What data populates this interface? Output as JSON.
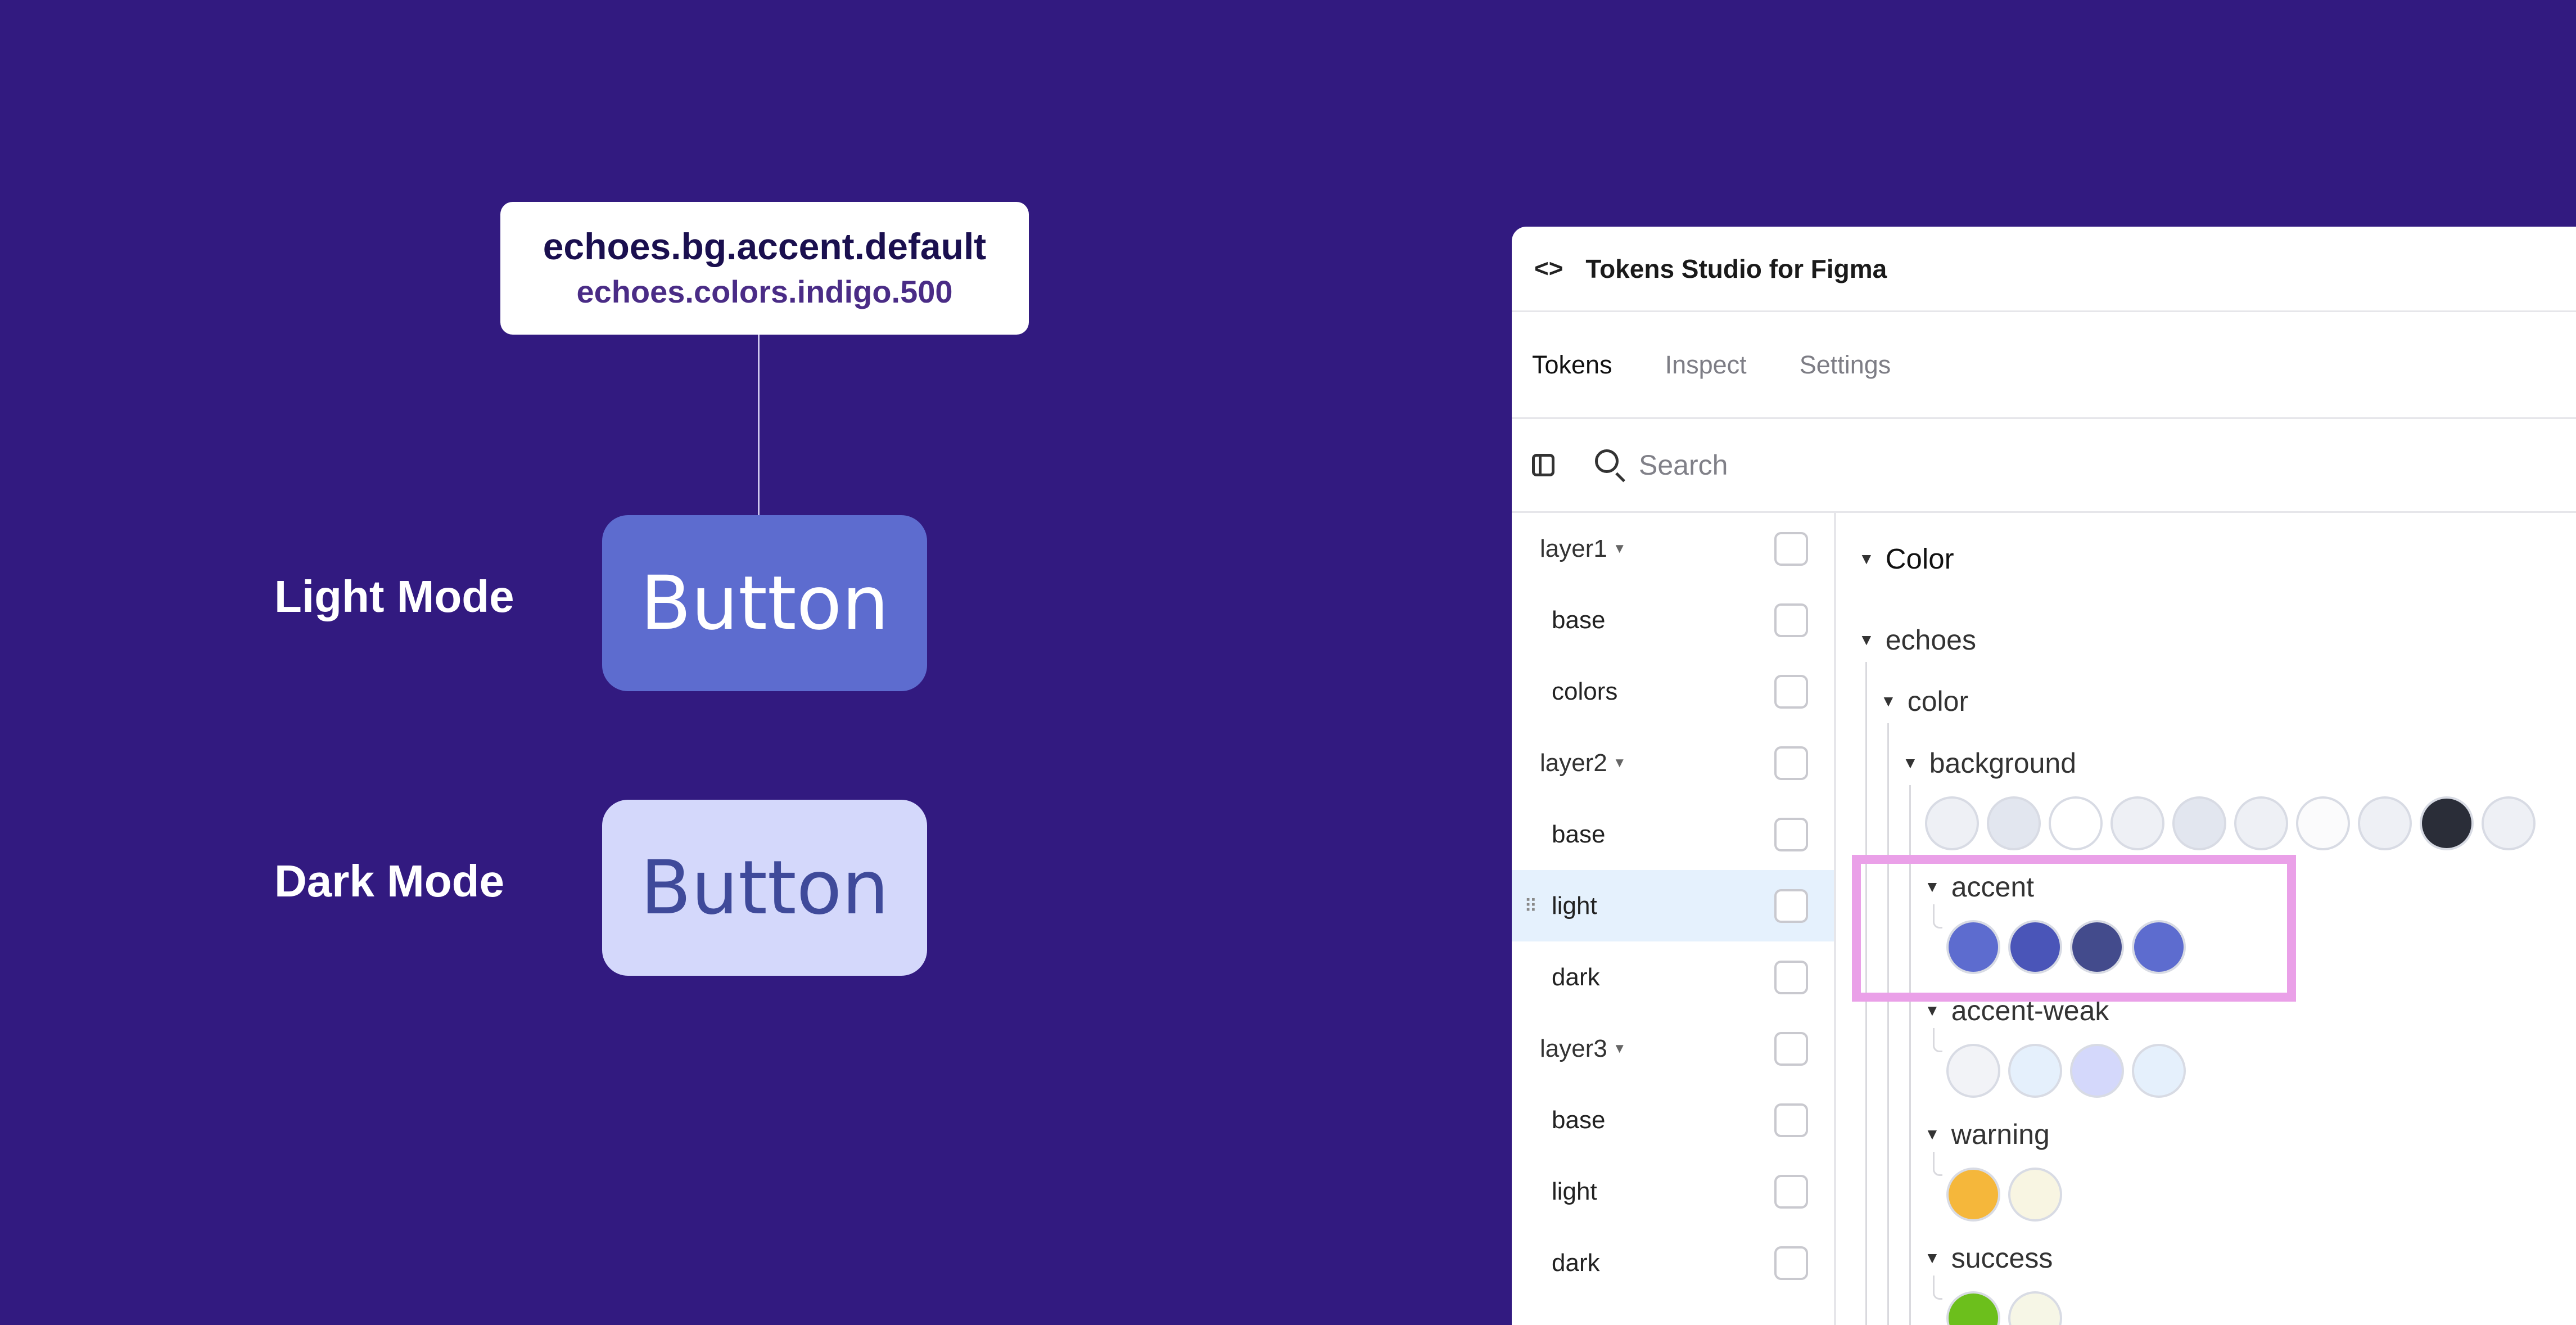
{
  "showcase": {
    "token_name": "echoes.bg.accent.default",
    "token_ref": "echoes.colors.indigo.500",
    "light_label": "Light Mode",
    "dark_label": "Dark Mode",
    "light_button": {
      "label": "Button",
      "bg": "#5d6ccf",
      "fg": "#ffffff"
    },
    "dark_button": {
      "label": "Button",
      "bg": "#d4d8fb",
      "fg": "#3f4a9a"
    }
  },
  "plugin": {
    "title": "Tokens Studio for Figma",
    "tabs": [
      {
        "label": "Tokens",
        "active": true
      },
      {
        "label": "Inspect",
        "active": false
      },
      {
        "label": "Settings",
        "active": false
      }
    ],
    "search": {
      "placeholder": "Search",
      "value": ""
    },
    "themes": [
      {
        "label": "layer1",
        "type": "group"
      },
      {
        "label": "base",
        "type": "child"
      },
      {
        "label": "colors",
        "type": "child"
      },
      {
        "label": "layer2",
        "type": "group"
      },
      {
        "label": "base",
        "type": "child"
      },
      {
        "label": "light",
        "type": "child",
        "active": true
      },
      {
        "label": "dark",
        "type": "child"
      },
      {
        "label": "layer3",
        "type": "group"
      },
      {
        "label": "base",
        "type": "child"
      },
      {
        "label": "light",
        "type": "child"
      },
      {
        "label": "dark",
        "type": "child"
      }
    ],
    "tree": {
      "root": "Color",
      "set": "echoes",
      "category": "color",
      "groups": [
        {
          "name": "background",
          "swatches": [
            "#eef0f5",
            "#e2e6ef",
            "#ffffff",
            "#eef0f5",
            "#e2e6ef",
            "#eef0f5",
            "#fbfbfc",
            "#eef0f5",
            "#2a2d38",
            "#eef0f5"
          ]
        },
        {
          "name": "accent",
          "swatches": [
            "#5d6ccf",
            "#4a55b8",
            "#434b8c",
            "#5d6ccf"
          ]
        },
        {
          "name": "accent-weak",
          "swatches": [
            "#f2f3f7",
            "#e5f0fc",
            "#d4d8fb",
            "#e5f0fc"
          ]
        },
        {
          "name": "warning",
          "swatches": [
            "#f5b73b",
            "#f8f5e2"
          ]
        },
        {
          "name": "success",
          "swatches": [
            "#6cbf1c",
            "#f6f6e6"
          ]
        }
      ]
    },
    "highlight_color": "#eaa0e8"
  }
}
